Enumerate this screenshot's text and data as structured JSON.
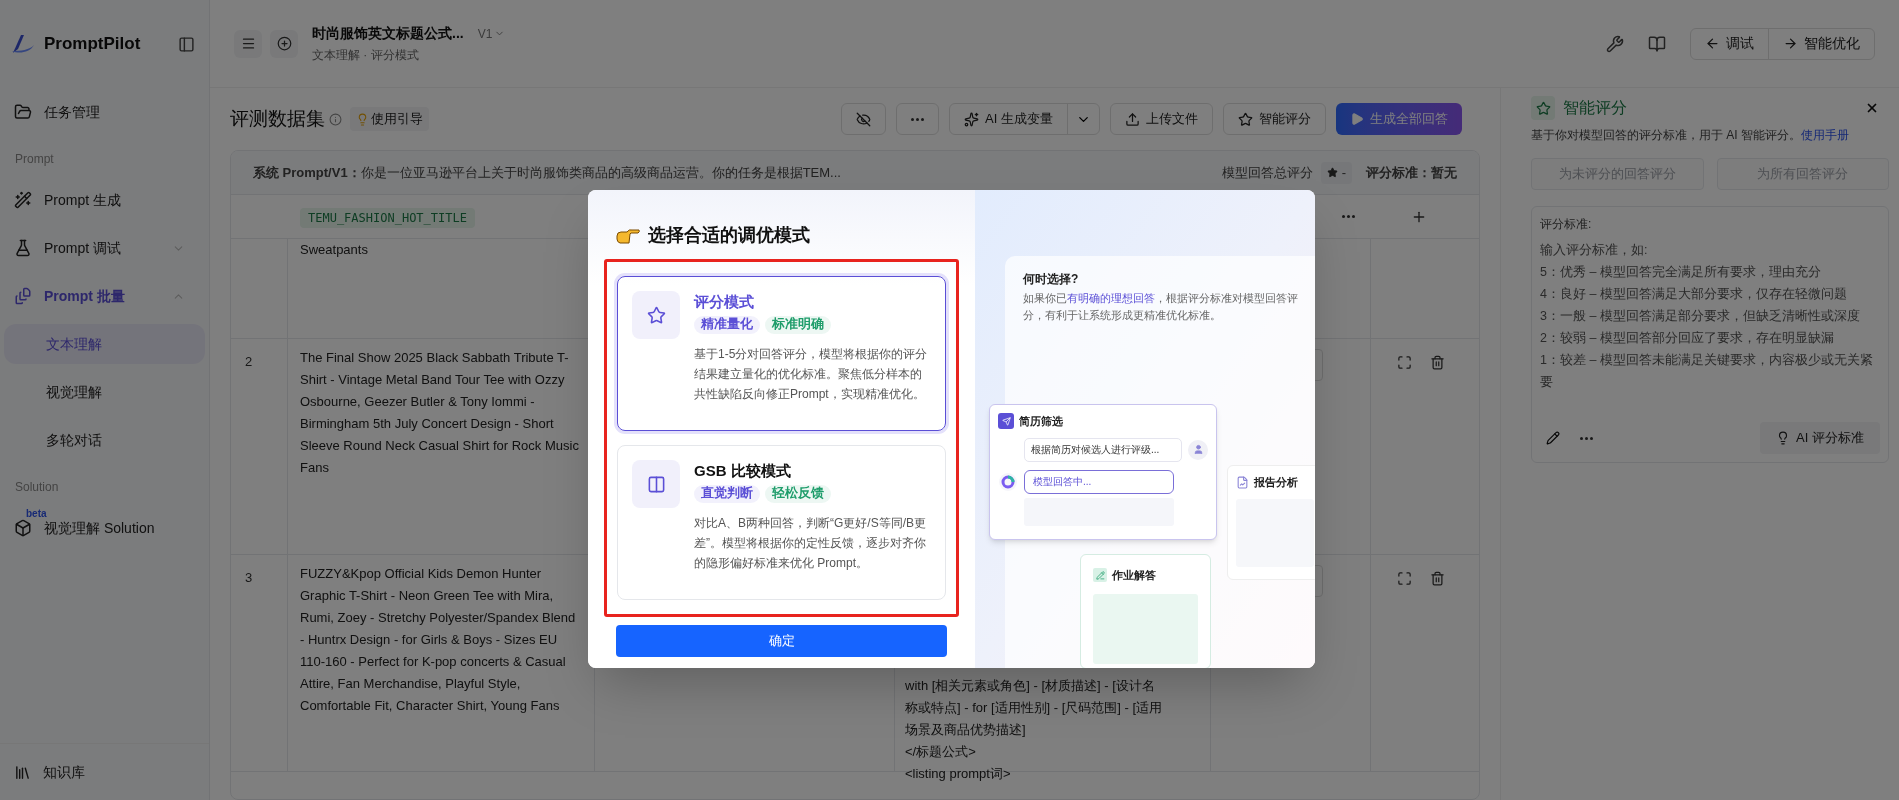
{
  "sidebar": {
    "logo": "PromptPilot",
    "items": [
      {
        "kind": "item",
        "label": "任务管理"
      },
      {
        "kind": "section",
        "label": "Prompt"
      },
      {
        "kind": "item",
        "label": "Prompt 生成"
      },
      {
        "kind": "group",
        "label": "Prompt 调试",
        "expanded": false
      },
      {
        "kind": "group",
        "label": "Prompt 批量",
        "expanded": true,
        "children": [
          {
            "label": "文本理解",
            "selected": true
          },
          {
            "label": "视觉理解",
            "selected": false
          },
          {
            "label": "多轮对话",
            "selected": false
          }
        ]
      },
      {
        "kind": "section",
        "label": "Solution"
      },
      {
        "kind": "item",
        "label": "视觉理解 Solution",
        "badge": "beta"
      }
    ],
    "footer": "知识库"
  },
  "header": {
    "title": "时尚服饰英文标题公式...",
    "version": "V1",
    "breadcrumb": "文本理解 · 评分模式",
    "buttons": [
      "调试",
      "智能优化"
    ]
  },
  "toolbar": {
    "title": "评测数据集",
    "guide": "使用引导",
    "actions": [
      "AI 生成变量",
      "上传文件",
      "智能评分",
      "生成全部回答"
    ]
  },
  "system_bar": {
    "prompt": "**系统 Prompt/V1：**你是一位亚马逊平台上关于时尚服饰类商品的高级商品运营。你的任务是根据TEM...",
    "score_label": "模型回答总评分",
    "score_value": "-",
    "criteria": "评分标准：暂无"
  },
  "table": {
    "columns": [
      {
        "label": "TEMU_FASHION_HOT_TITLE"
      }
    ],
    "rows": [
      {
        "index": "",
        "title": "Sweatpants",
        "output_lines": []
      },
      {
        "index": "2",
        "title": "The Final Show 2025 Black Sabbath Tribute T-Shirt - Vintage Metal Band Tour Tee with Ozzy Osbourne, Geezer Butler & Tony Iommi - Birmingham 5th July Concert Design - Short Sleeve Round Neck Casual Shirt for Rock Music Fans",
        "output_lines": []
      },
      {
        "index": "3",
        "title": "FUZZY&Kpop Official Kids Demon Hunter Graphic T-Shirt - Neon Green Tee with Mira, Rumi, Zoey - Stretchy Polyester/Spandex Blend - Huntrx Design - for Girls & Boys - Sizes EU 110-160 - Perfect for K-pop concerts & Casual Attire, Fan Merchandise, Playful Style, Comfortable Fit, Character Shirt, Young Fans",
        "output_lines": [
          "with [相关元素或角色] - [材质描述] - [设计名",
          "称或特点] - for [适用性别] - [尺码范围] - [适用",
          "场景及商品优势描述]",
          "</标题公式>",
          "<listing prompt词>"
        ]
      }
    ]
  },
  "right_panel": {
    "title": "智能评分",
    "description": "基于你对模型回答的评分标准，用于 AI 智能评分。",
    "link": "使用手册",
    "buttons": [
      {
        "label": "为未评分的回答评分",
        "disabled": true
      },
      {
        "label": "为所有回答评分",
        "disabled": true
      }
    ],
    "criteria_label": "评分标准:",
    "placeholder": "输入评分标准，如:\n5：优秀 – 模型回答完全满足所有要求，理由充分\n4：良好 – 模型回答满足大部分要求，仅存在轻微问题\n3：一般 – 模型回答满足部分要求，但缺乏清晰性或深度\n2：较弱 – 模型回答部分回应了要求，存在明显缺漏\n1：较差 – 模型回答未能满足关键要求，内容极少或无关紧要",
    "ai_button": "AI 评分标准"
  },
  "modal": {
    "title": "选择合适的调优模式",
    "options": [
      {
        "title": "评分模式",
        "selected": true,
        "tags": [
          {
            "label": "精准量化",
            "color": "#5b4fd6"
          },
          {
            "label": "标准明确",
            "color": "#1f9d6b"
          }
        ],
        "description": "基于1-5分对回答评分，模型将根据你的评分结果建立量化的优化标准。聚焦低分样本的共性缺陷反向修正Prompt，实现精准优化。"
      },
      {
        "title": "GSB 比较模式",
        "selected": false,
        "tags": [
          {
            "label": "直觉判断",
            "color": "#5b4fd6"
          },
          {
            "label": "轻松反馈",
            "color": "#1f9d6b"
          }
        ],
        "description": "对比A、B两种回答，判断“G更好/S等同/B更差”。模型将根据你的定性反馈，逐步对齐你的隐形偏好标准来优化 Prompt。"
      }
    ],
    "confirm": "确定",
    "info": {
      "title": "何时选择?",
      "description": [
        {
          "text": "如果你已",
          "highlight": false
        },
        {
          "text": "有明确的理想回答",
          "highlight": true
        },
        {
          "text": "，根据评分标准对模型回答评分，有利于让系统形成更精准优化标准。",
          "highlight": false
        }
      ],
      "cards": [
        {
          "kind": "chat",
          "title": "简历筛选",
          "prompt": "根据简历对候选人进行评级...",
          "reply": "模型回答中..."
        },
        {
          "kind": "report",
          "title": "报告分析"
        },
        {
          "kind": "homework",
          "title": "作业解答"
        }
      ]
    }
  }
}
